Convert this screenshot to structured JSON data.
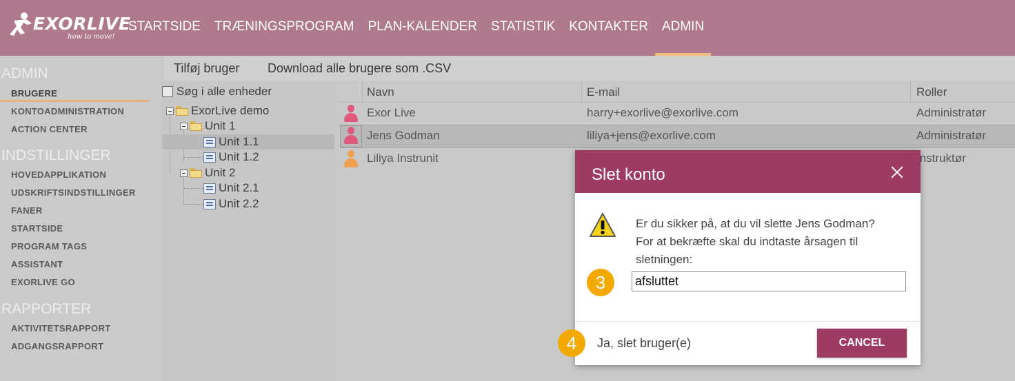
{
  "app": {
    "logo_text": "EXORLIVE",
    "logo_tagline": "how to move!"
  },
  "nav": {
    "items": [
      {
        "label": "STARTSIDE"
      },
      {
        "label": "TRÆNINGSPROGRAM"
      },
      {
        "label": "PLAN-KALENDER"
      },
      {
        "label": "STATISTIK"
      },
      {
        "label": "KONTAKTER"
      },
      {
        "label": "ADMIN",
        "active": true
      }
    ]
  },
  "sidebar": {
    "sections": [
      {
        "title": "ADMIN",
        "items": [
          "BRUGERE",
          "KONTOADMINISTRATION",
          "ACTION CENTER"
        ]
      },
      {
        "title": "INDSTILLINGER",
        "items": [
          "HOVEDAPPLIKATION",
          "UDSKRIFTSINDSTILLINGER",
          "FANER",
          "STARTSIDE",
          "PROGRAM TAGS",
          "ASSISTANT",
          "EXORLIVE GO"
        ]
      },
      {
        "title": "RAPPORTER",
        "items": [
          "AKTIVITETSRAPPORT",
          "ADGANGSRAPPORT"
        ]
      }
    ],
    "active_item": "BRUGERE"
  },
  "toolbar": {
    "add_user": "Tilføj bruger",
    "download_csv": "Download alle brugere som .CSV"
  },
  "tree": {
    "search_all_label": "Søg i alle enheder",
    "search_all_checked": false,
    "nodes": [
      {
        "label": "ExorLive demo"
      },
      {
        "label": "Unit 1"
      },
      {
        "label": "Unit 1.1",
        "selected": true
      },
      {
        "label": "Unit 1.2"
      },
      {
        "label": "Unit 2"
      },
      {
        "label": "Unit 2.1"
      },
      {
        "label": "Unit 2.2"
      }
    ]
  },
  "grid": {
    "columns": [
      "Navn",
      "E-mail",
      "Roller"
    ],
    "rows": [
      {
        "name": "Exor Live",
        "email": "harry+exorlive@exorlive.com",
        "role": "Administratør",
        "icon_color": "#e0587e"
      },
      {
        "name": "Jens Godman",
        "email": "liliya+jens@exorlive.com",
        "role": "Administratør",
        "icon_color": "#e0587e",
        "selected": true
      },
      {
        "name": "Liliya Instrunit",
        "email": "",
        "role": "Instruktør",
        "icon_color": "#f0a050"
      }
    ]
  },
  "dialog": {
    "title": "Slet konto",
    "message_lines": [
      "Er du sikker på, at du vil slette Jens Godman?",
      "For at bekræfte skal du indtaste årsagen til",
      "sletningen:"
    ],
    "reason_value": "afsluttet",
    "confirm_label": "Ja, slet bruger(e)",
    "cancel_label": "CANCEL"
  },
  "badges": {
    "step3": "3",
    "step4": "4"
  },
  "colors": {
    "header": "#b07a8e",
    "accent": "#9e3b63",
    "nav_active_underline": "#f2c07a",
    "badge": "#f2a900"
  }
}
